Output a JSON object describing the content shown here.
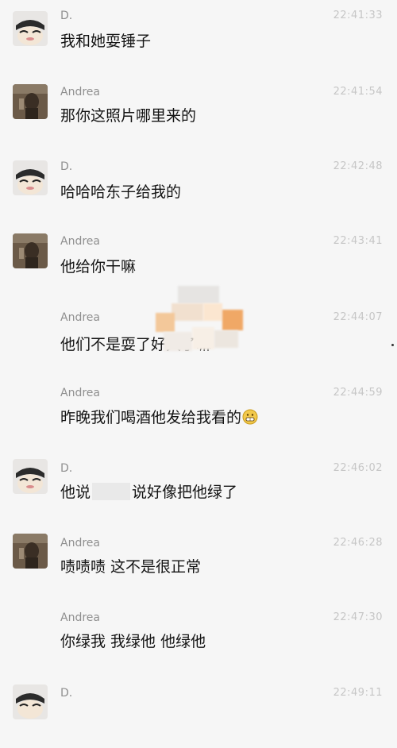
{
  "messages": [
    {
      "sender": "D.",
      "time": "22:41:33",
      "text": "我和她耍锤子",
      "avatar": "cartoon-avatar"
    },
    {
      "sender": "Andrea",
      "time": "22:41:54",
      "text": "那你这照片哪里来的",
      "avatar": "photo-avatar"
    },
    {
      "sender": "D.",
      "time": "22:42:48",
      "text": "哈哈哈东子给我的",
      "avatar": "cartoon-avatar"
    },
    {
      "sender": "Andrea",
      "time": "22:43:41",
      "text": "他给你干嘛",
      "avatar": "photo-avatar"
    },
    {
      "sender": "Andrea",
      "time": "22:44:07",
      "text": "他们不是耍了好久了嘛",
      "avatar": "none"
    },
    {
      "sender": "Andrea",
      "time": "22:44:59",
      "text": "昨晚我们喝酒他发给我看的",
      "avatar": "none",
      "emoji": "grinning-emoji"
    },
    {
      "sender": "D.",
      "time": "22:46:02",
      "text_before": "他说",
      "text_after": "说好像把他绿了",
      "avatar": "cartoon-avatar",
      "redacted": true
    },
    {
      "sender": "Andrea",
      "time": "22:46:28",
      "text": "啧啧啧 这不是很正常",
      "avatar": "photo-avatar"
    },
    {
      "sender": "Andrea",
      "time": "22:47:30",
      "text": "你绿我 我绿他 他绿他",
      "avatar": "none"
    },
    {
      "sender": "D.",
      "time": "22:49:11",
      "text": "",
      "avatar": "cartoon-avatar"
    }
  ],
  "colors": {
    "background": "#f6f6f6",
    "name": "#8f8f8f",
    "time": "#c6c6c6",
    "text": "#141414"
  }
}
